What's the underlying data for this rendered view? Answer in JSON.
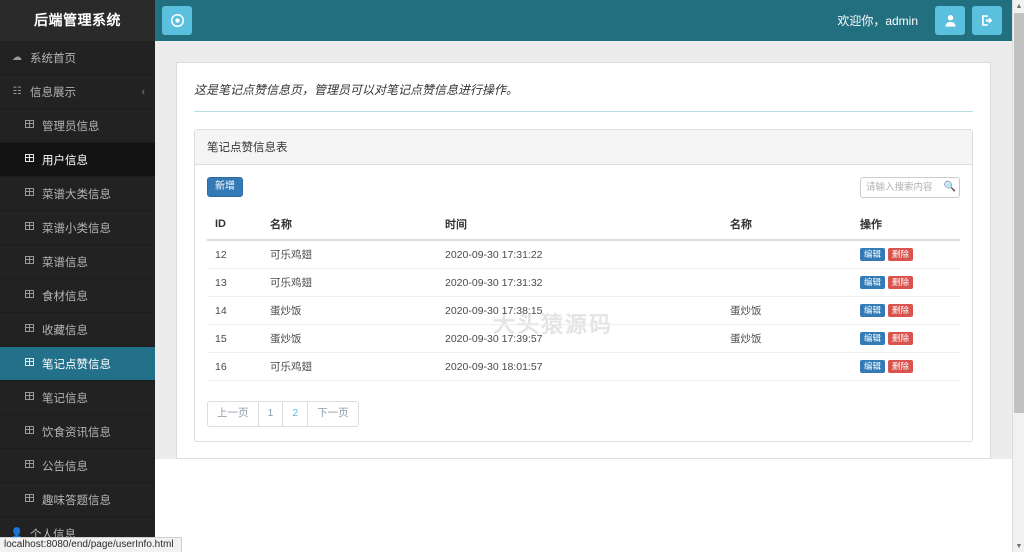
{
  "sidebar": {
    "brand": "后端管理系统",
    "items": [
      {
        "label": "系统首页",
        "icon": "dashboard-icon",
        "type": "top",
        "state": "normal"
      },
      {
        "label": "信息展示",
        "icon": "sitemap-icon",
        "type": "top",
        "state": "normal",
        "caret": "‹"
      },
      {
        "label": "管理员信息",
        "icon": "table-icon",
        "type": "sub",
        "state": "normal"
      },
      {
        "label": "用户信息",
        "icon": "table-icon",
        "type": "sub",
        "state": "hover"
      },
      {
        "label": "菜谱大类信息",
        "icon": "table-icon",
        "type": "sub",
        "state": "normal"
      },
      {
        "label": "菜谱小类信息",
        "icon": "table-icon",
        "type": "sub",
        "state": "normal"
      },
      {
        "label": "菜谱信息",
        "icon": "table-icon",
        "type": "sub",
        "state": "normal"
      },
      {
        "label": "食材信息",
        "icon": "table-icon",
        "type": "sub",
        "state": "normal"
      },
      {
        "label": "收藏信息",
        "icon": "table-icon",
        "type": "sub",
        "state": "normal"
      },
      {
        "label": "笔记点赞信息",
        "icon": "table-icon",
        "type": "sub",
        "state": "active"
      },
      {
        "label": "笔记信息",
        "icon": "table-icon",
        "type": "sub",
        "state": "normal"
      },
      {
        "label": "饮食资讯信息",
        "icon": "table-icon",
        "type": "sub",
        "state": "normal"
      },
      {
        "label": "公告信息",
        "icon": "table-icon",
        "type": "sub",
        "state": "normal"
      },
      {
        "label": "趣味答题信息",
        "icon": "table-icon",
        "type": "sub",
        "state": "normal"
      },
      {
        "label": "个人信息",
        "icon": "user-icon",
        "type": "top",
        "state": "normal"
      }
    ]
  },
  "header": {
    "toggle_icon": "target-icon",
    "welcome": "欢迎你，admin",
    "user_icon": "user-icon",
    "logout_icon": "logout-icon"
  },
  "main": {
    "page_description": "这是笔记点赞信息页，管理员可以对笔记点赞信息进行操作。",
    "panel_title": "笔记点赞信息表",
    "add_label": "新增",
    "search_placeholder": "请输入搜索内容",
    "search_value": "",
    "search_icon": "search-icon",
    "watermark": "大头猿源码",
    "table": {
      "columns": [
        "ID",
        "名称",
        "时间",
        "名称",
        "操作"
      ],
      "rows": [
        {
          "id": "12",
          "name": "可乐鸡翅",
          "time": "2020-09-30 17:31:22",
          "name2": "",
          "edit": "编辑",
          "delete": "删除"
        },
        {
          "id": "13",
          "name": "可乐鸡翅",
          "time": "2020-09-30 17:31:32",
          "name2": "",
          "edit": "编辑",
          "delete": "删除"
        },
        {
          "id": "14",
          "name": "蛋炒饭",
          "time": "2020-09-30 17:38:15",
          "name2": "蛋炒饭",
          "edit": "编辑",
          "delete": "删除"
        },
        {
          "id": "15",
          "name": "蛋炒饭",
          "time": "2020-09-30 17:39:57",
          "name2": "蛋炒饭",
          "edit": "编辑",
          "delete": "删除"
        },
        {
          "id": "16",
          "name": "可乐鸡翅",
          "time": "2020-09-30 18:01:57",
          "name2": "",
          "edit": "编辑",
          "delete": "删除"
        }
      ]
    },
    "pagination": {
      "prev": "上一页",
      "pages": [
        {
          "label": "1",
          "current": false
        },
        {
          "label": "2",
          "current": true
        }
      ],
      "next": "下一页"
    }
  },
  "status_bar": {
    "url": "localhost:8080/end/page/userInfo.html"
  },
  "colors": {
    "header_teal": "#226f80",
    "accent_light_blue": "#5bc0de",
    "sidebar_dark": "#222222",
    "primary_blue": "#337ab7",
    "danger_red": "#d9534f"
  }
}
